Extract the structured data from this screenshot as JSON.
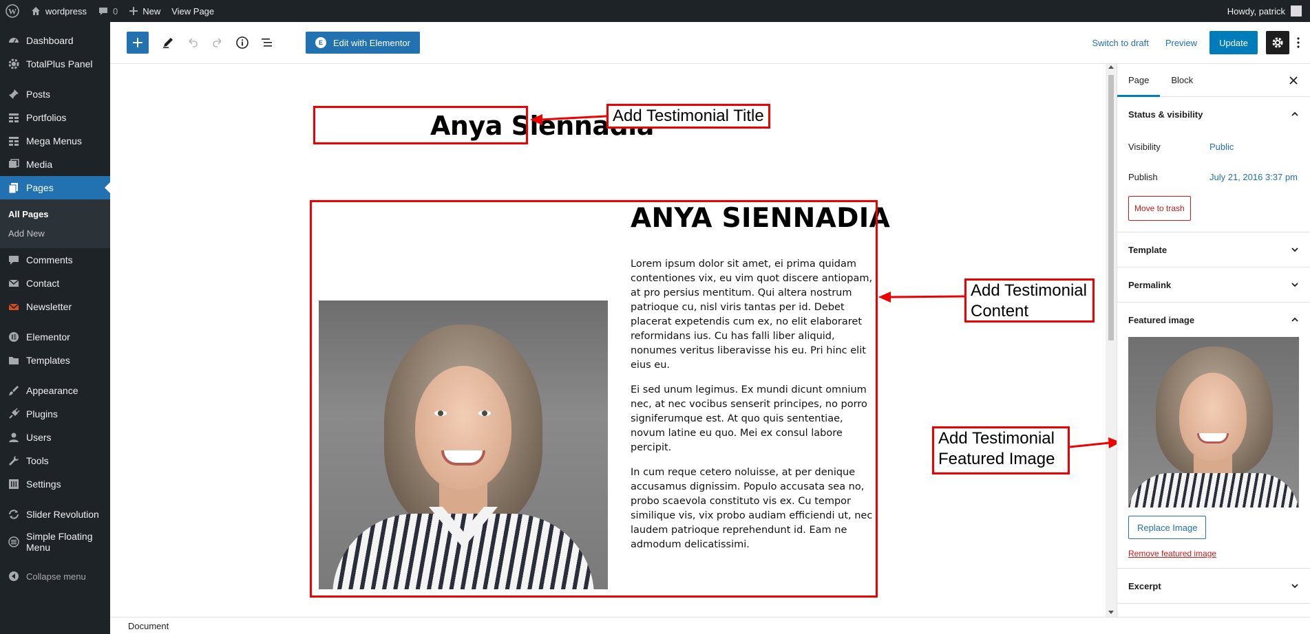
{
  "adminbar": {
    "site_name": "wordpress",
    "comments_count": "0",
    "new_label": "New",
    "view_page_label": "View Page",
    "howdy": "Howdy, patrick"
  },
  "sidebar": {
    "items": [
      {
        "label": "Dashboard",
        "icon": "dashboard-icon"
      },
      {
        "label": "TotalPlus Panel",
        "icon": "gear-icon"
      },
      {
        "label": "Posts",
        "icon": "pin-icon"
      },
      {
        "label": "Portfolios",
        "icon": "grid-icon"
      },
      {
        "label": "Mega Menus",
        "icon": "grid-icon"
      },
      {
        "label": "Media",
        "icon": "media-icon"
      },
      {
        "label": "Pages",
        "icon": "pages-icon"
      },
      {
        "label": "Comments",
        "icon": "comment-icon"
      },
      {
        "label": "Contact",
        "icon": "mail-icon"
      },
      {
        "label": "Newsletter",
        "icon": "newsletter-icon"
      },
      {
        "label": "Elementor",
        "icon": "elementor-icon"
      },
      {
        "label": "Templates",
        "icon": "folder-icon"
      },
      {
        "label": "Appearance",
        "icon": "brush-icon"
      },
      {
        "label": "Plugins",
        "icon": "plug-icon"
      },
      {
        "label": "Users",
        "icon": "user-icon"
      },
      {
        "label": "Tools",
        "icon": "wrench-icon"
      },
      {
        "label": "Settings",
        "icon": "settings-icon"
      },
      {
        "label": "Slider Revolution",
        "icon": "refresh-icon"
      },
      {
        "label": "Simple Floating Menu",
        "icon": "menu-icon"
      }
    ],
    "submenu": {
      "all_pages": "All Pages",
      "add_new": "Add New"
    },
    "collapse": "Collapse menu"
  },
  "toolbar": {
    "elementor_label": "Edit with Elementor",
    "elementor_icon_letter": "E",
    "switch_to_draft": "Switch to draft",
    "preview": "Preview",
    "update": "Update"
  },
  "editor": {
    "title": "Anya Siennadia",
    "heading": "ANYA SIENNADIA",
    "paragraphs": [
      "Lorem ipsum dolor sit amet, ei prima quidam contentiones vix, eu vim quot discere antiopam, at pro persius mentitum. Qui altera nostrum patrioque cu, nisl viris tantas per id. Debet placerat expetendis cum ex, no elit elaboraret reformidans ius. Cu has falli liber aliquid, nonumes veritus liberavisse his eu. Pri hinc elit eius eu.",
      "Ei sed unum legimus. Ex mundi dicunt omnium nec, at nec vocibus senserit principes, no porro signiferumque est. At quo quis sententiae, novum latine eu quo. Mei ex consul labore percipit.",
      "In cum reque cetero noluisse, at per denique accusamus dignissim. Populo accusata sea no, probo scaevola constituto vis ex. Cu tempor similique vis, vix probo audiam efficiendi ut, nec laudem patrioque reprehendunt id. Eam ne admodum delicatissimi."
    ]
  },
  "callouts": {
    "title": "Add Testimonial Title",
    "content": "Add Testimonial\nContent",
    "image": "Add Testimonial\nFeatured Image"
  },
  "statusbar": {
    "label": "Document"
  },
  "settings": {
    "tabs": [
      "Page",
      "Block"
    ],
    "status_panel": "Status & visibility",
    "visibility_label": "Visibility",
    "visibility_value": "Public",
    "publish_label": "Publish",
    "publish_value": "July 21, 2016 3:37 pm",
    "trash": "Move to trash",
    "template_panel": "Template",
    "permalink_panel": "Permalink",
    "featured_panel": "Featured image",
    "replace": "Replace Image",
    "remove": "Remove featured image",
    "excerpt_panel": "Excerpt"
  },
  "colors": {
    "accent": "#2271b1",
    "annotation": "#ee0000",
    "admin_bg": "#1d2327"
  }
}
